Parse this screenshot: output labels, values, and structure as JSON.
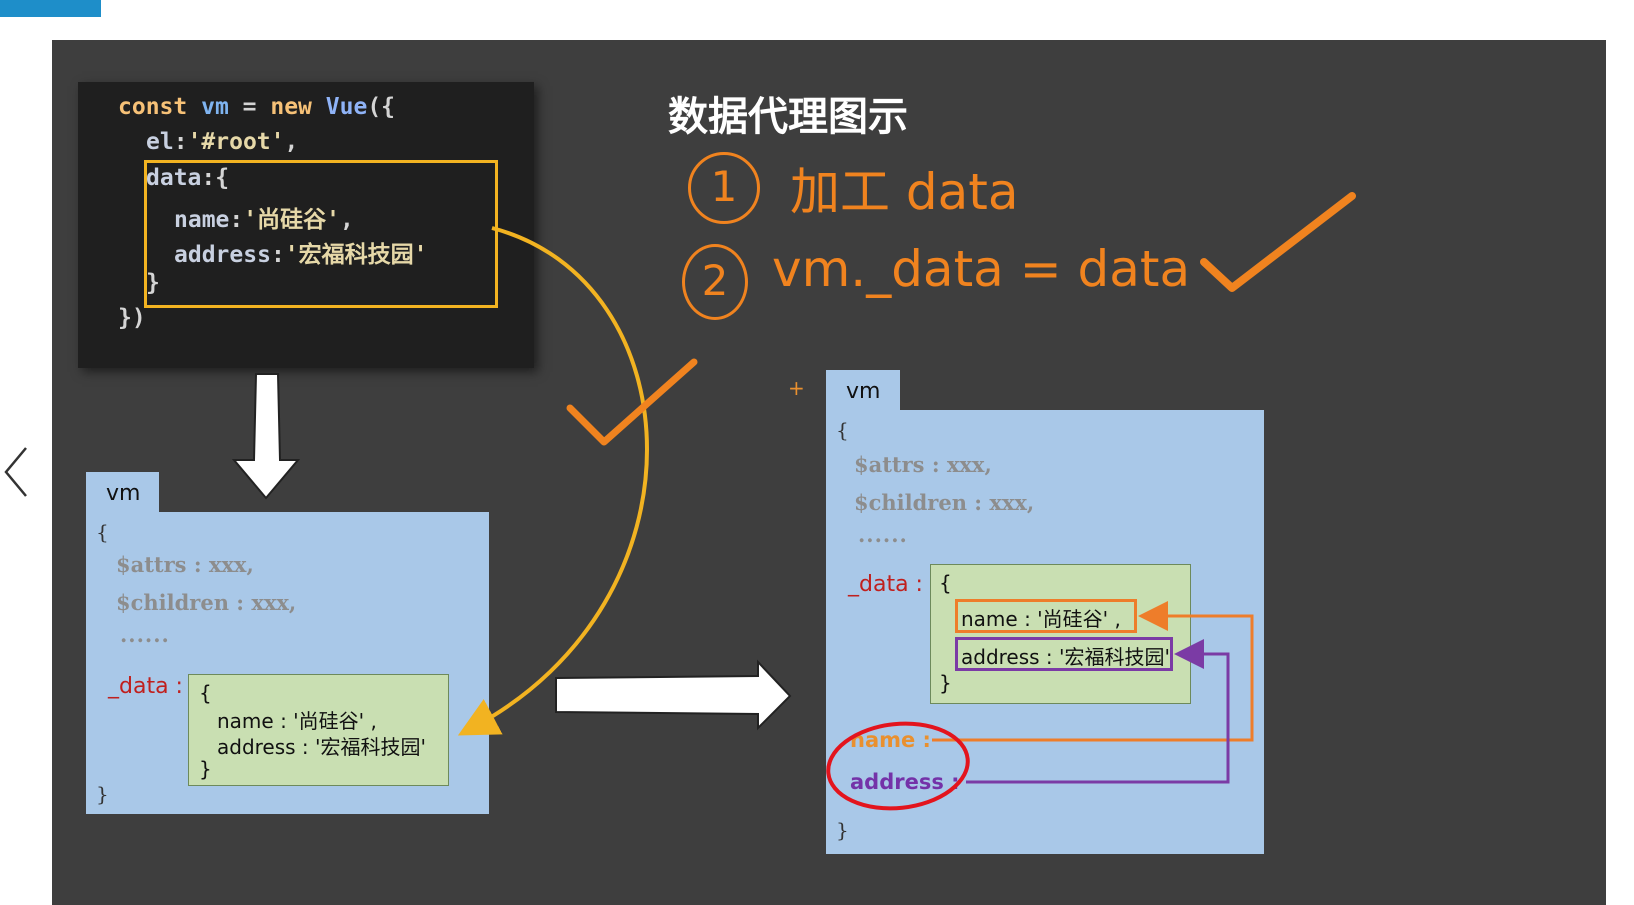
{
  "colors": {
    "slide_bg": "#3e3e3e",
    "accent_tab": "#1e8ec9",
    "vm_panel": "#a9c8e8",
    "data_box": "#c9dfb2",
    "highlight_yellow": "#f2b321",
    "pen_orange": "#f0831f",
    "purple": "#7b3ba5",
    "red_circle": "#e3141d"
  },
  "icons": {
    "prev": "chevron-left-icon"
  },
  "code": {
    "l1": {
      "kw": "const",
      "id": "vm",
      "eq": " = ",
      "kw2": "new",
      "fn": "Vue",
      "end": "({"
    },
    "l2": {
      "key": "el",
      "val": "'#root'",
      "end": ","
    },
    "l3": {
      "key": "data",
      "end": ":{"
    },
    "l4": {
      "key": "name",
      "val": "'尚硅谷'",
      "end": ","
    },
    "l5": {
      "key": "address",
      "val": "'宏福科技园'"
    },
    "l6": "}",
    "l7": "})"
  },
  "title": "数据代理图示",
  "steps": {
    "s1_num": "1",
    "s1_text": "加工 data",
    "s2_num": "2",
    "s2_text": "vm._data = data"
  },
  "vm_left": {
    "tab": "vm",
    "open": "{",
    "attrs": "$attrs : xxx,",
    "children": "$children : xxx,",
    "dots": "......",
    "data_key": "_data :",
    "inner_open": "{",
    "name_line": "name : '尚硅谷' ,",
    "address_line": "address : '宏福科技园'",
    "inner_close": "}",
    "close": "}"
  },
  "vm_right": {
    "plus": "+",
    "tab": "vm",
    "open": "{",
    "attrs": "$attrs : xxx,",
    "children": "$children : xxx,",
    "dots": "......",
    "data_key": "_data :",
    "inner_open": "{",
    "name_line": "name : '尚硅谷' ,",
    "address_line": "address : '宏福科技园'",
    "inner_close": "}",
    "proxy_name": "name :",
    "proxy_address": "address :",
    "close": "}"
  }
}
